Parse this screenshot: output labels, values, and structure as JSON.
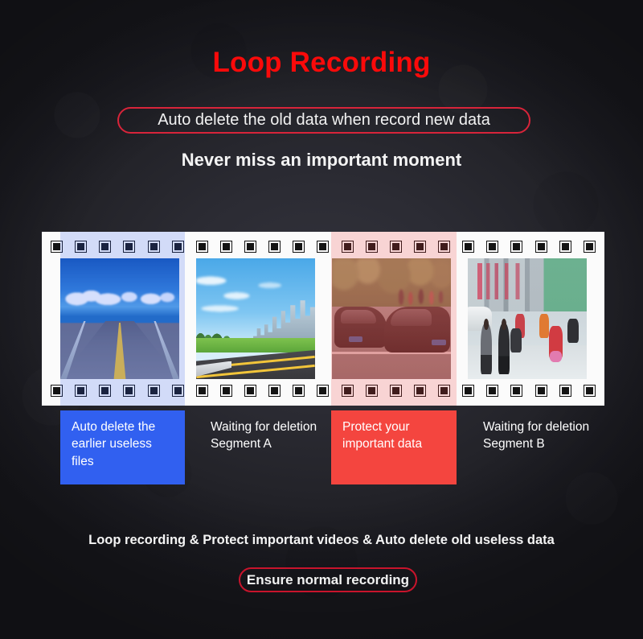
{
  "header": {
    "title": "Loop Recording",
    "subtitle_pill": "Auto delete the old data when record new data",
    "tagline": "Never miss an important moment"
  },
  "filmstrip": {
    "sprocket_count": 23,
    "frames": [
      {
        "icon": "photo-bridge-road",
        "alt": "Empty bridge road over blue ocean under blue sky"
      },
      {
        "icon": "photo-city-highway",
        "alt": "Highway beside green grass with distant city skyline"
      },
      {
        "icon": "photo-car-collision",
        "alt": "Two dark cars in a collision on a street"
      },
      {
        "icon": "photo-busy-street",
        "alt": "Busy street with pedestrians and scooters"
      }
    ]
  },
  "captions": [
    {
      "text": "Auto delete the earlier useless files",
      "state": "deleting",
      "color": "#3160f0"
    },
    {
      "text": "Waiting for deletion Segment A",
      "state": "waiting",
      "color": "#00000000"
    },
    {
      "text": "Protect your important data",
      "state": "protected",
      "color": "#f4453f"
    },
    {
      "text": "Waiting for deletion Segment B",
      "state": "waiting",
      "color": "#00000000"
    }
  ],
  "footer": {
    "summary": "Loop recording & Protect important videos & Auto delete old useless data",
    "pill": "Ensure normal recording"
  },
  "colors": {
    "background": "#2b2b33",
    "title_red": "#fa0a0a",
    "outline_red": "#d8243a",
    "delete_blue": "#3160f0",
    "protect_red": "#f4453f",
    "film_white": "#fbfbfb",
    "text_white": "#f4f4f4"
  }
}
